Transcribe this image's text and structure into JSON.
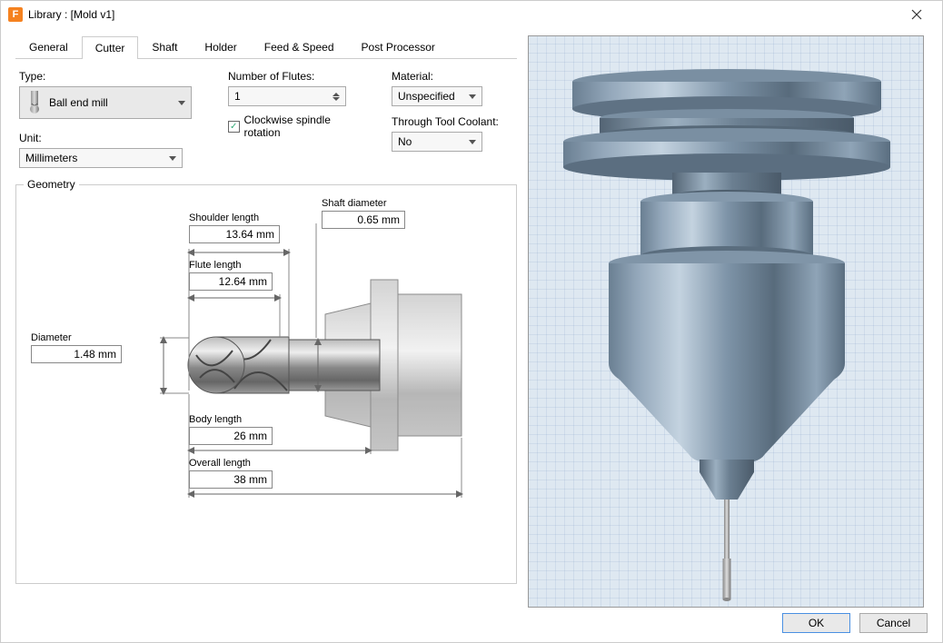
{
  "window": {
    "title": "Library : [Mold v1]"
  },
  "tabs": [
    "General",
    "Cutter",
    "Shaft",
    "Holder",
    "Feed & Speed",
    "Post Processor"
  ],
  "active_tab": "Cutter",
  "type": {
    "label": "Type:",
    "value": "Ball end mill"
  },
  "unit": {
    "label": "Unit:",
    "value": "Millimeters"
  },
  "flutes": {
    "label": "Number of Flutes:",
    "value": "1"
  },
  "clockwise": {
    "label": "Clockwise spindle rotation",
    "checked": true
  },
  "material": {
    "label": "Material:",
    "value": "Unspecified"
  },
  "coolant": {
    "label": "Through Tool Coolant:",
    "value": "No"
  },
  "geometry": {
    "legend": "Geometry",
    "diameter": {
      "label": "Diameter",
      "value": "1.48 mm"
    },
    "shoulder_length": {
      "label": "Shoulder length",
      "value": "13.64 mm"
    },
    "flute_length": {
      "label": "Flute length",
      "value": "12.64 mm"
    },
    "body_length": {
      "label": "Body length",
      "value": "26 mm"
    },
    "overall_length": {
      "label": "Overall length",
      "value": "38 mm"
    },
    "shaft_diameter": {
      "label": "Shaft diameter",
      "value": "0.65 mm"
    }
  },
  "buttons": {
    "ok": "OK",
    "cancel": "Cancel"
  }
}
